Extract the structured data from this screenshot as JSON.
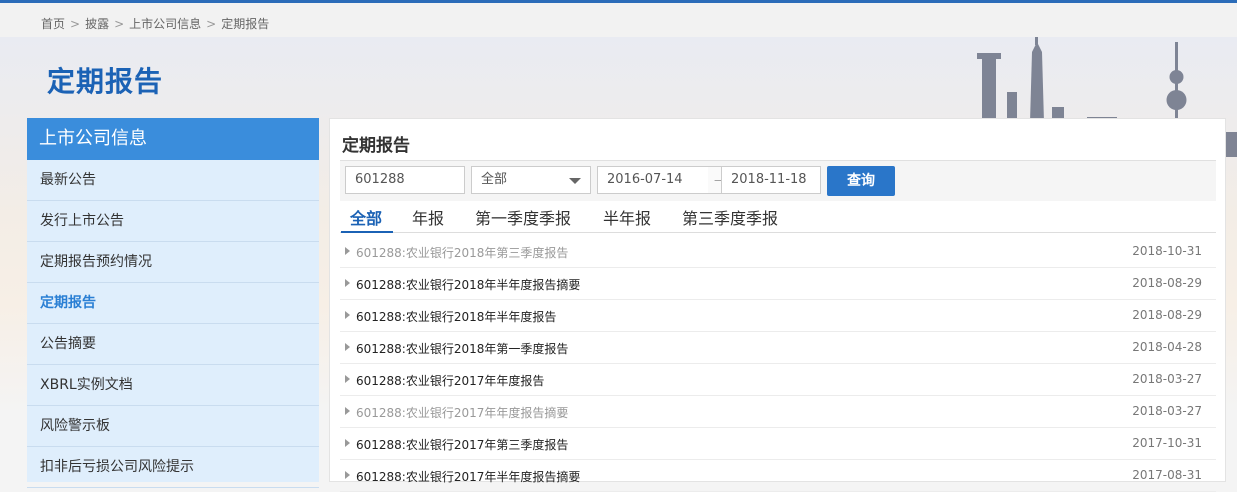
{
  "breadcrumb": [
    "首页",
    "披露",
    "上市公司信息",
    "定期报告"
  ],
  "page_title": "定期报告",
  "sidebar": {
    "title": "上市公司信息",
    "items": [
      {
        "label": "最新公告",
        "active": false
      },
      {
        "label": "发行上市公告",
        "active": false
      },
      {
        "label": "定期报告预约情况",
        "active": false
      },
      {
        "label": "定期报告",
        "active": true
      },
      {
        "label": "公告摘要",
        "active": false
      },
      {
        "label": "XBRL实例文档",
        "active": false
      },
      {
        "label": "风险警示板",
        "active": false
      },
      {
        "label": "扣非后亏损公司风险提示",
        "active": false
      }
    ]
  },
  "panel": {
    "title": "定期报告",
    "filter": {
      "code_value": "601288",
      "type_selected": "全部",
      "date_start": "2016-07-14",
      "date_sep": "—",
      "date_end": "2018-11-18",
      "query_label": "查询"
    },
    "tabs": [
      {
        "label": "全部",
        "active": true
      },
      {
        "label": "年报",
        "active": false
      },
      {
        "label": "第一季度季报",
        "active": false
      },
      {
        "label": "半年报",
        "active": false
      },
      {
        "label": "第三季度季报",
        "active": false
      }
    ],
    "reports": [
      {
        "title": "601288:农业银行2018年第三季度报告",
        "date": "2018-10-31",
        "visited": true
      },
      {
        "title": "601288:农业银行2018年半年度报告摘要",
        "date": "2018-08-29",
        "visited": false
      },
      {
        "title": "601288:农业银行2018年半年度报告",
        "date": "2018-08-29",
        "visited": false
      },
      {
        "title": "601288:农业银行2018年第一季度报告",
        "date": "2018-04-28",
        "visited": false
      },
      {
        "title": "601288:农业银行2017年年度报告",
        "date": "2018-03-27",
        "visited": false
      },
      {
        "title": "601288:农业银行2017年年度报告摘要",
        "date": "2018-03-27",
        "visited": true
      },
      {
        "title": "601288:农业银行2017年第三季度报告",
        "date": "2017-10-31",
        "visited": false
      },
      {
        "title": "601288:农业银行2017年半年度报告摘要",
        "date": "2017-08-31",
        "visited": false
      }
    ]
  }
}
